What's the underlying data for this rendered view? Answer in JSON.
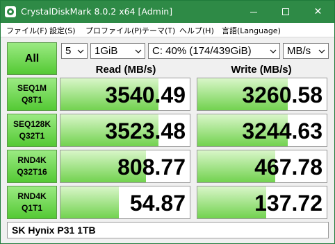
{
  "window": {
    "title": "CrystalDiskMark 8.0.2 x64 [Admin]",
    "minimize_glyph": "minimize-icon",
    "maximize_glyph": "maximize-icon",
    "close_glyph": "✕"
  },
  "menu": {
    "items": [
      "ファイル(F)",
      "設定(S)",
      "プロファイル(P)",
      "テーマ(T)",
      "ヘルプ(H)",
      "言語(Language)"
    ]
  },
  "controls": {
    "all_label": "All",
    "count": "5",
    "size": "1GiB",
    "drive": "C: 40% (174/439GiB)",
    "unit": "MB/s"
  },
  "headers": {
    "read": "Read (MB/s)",
    "write": "Write (MB/s)"
  },
  "tests": [
    {
      "line1": "SEQ1M",
      "line2": "Q8T1",
      "read": "3540.49",
      "write": "3260.58",
      "read_fill": 0.76,
      "write_fill": 0.7
    },
    {
      "line1": "SEQ128K",
      "line2": "Q32T1",
      "read": "3523.48",
      "write": "3244.63",
      "read_fill": 0.76,
      "write_fill": 0.7
    },
    {
      "line1": "RND4K",
      "line2": "Q32T16",
      "read": "808.77",
      "write": "467.78",
      "read_fill": 0.66,
      "write_fill": 0.6
    },
    {
      "line1": "RND4K",
      "line2": "Q1T1",
      "read": "54.87",
      "write": "137.72",
      "read_fill": 0.45,
      "write_fill": 0.53
    }
  ],
  "footer": {
    "drive_name": "SK Hynix P31 1TB"
  },
  "colors": {
    "titlebar": "#2e8a46",
    "button_green_top": "#9bea83",
    "button_green_bottom": "#54c934",
    "bar_top": "#d9f6c9",
    "bar_bottom": "#72d24f"
  }
}
